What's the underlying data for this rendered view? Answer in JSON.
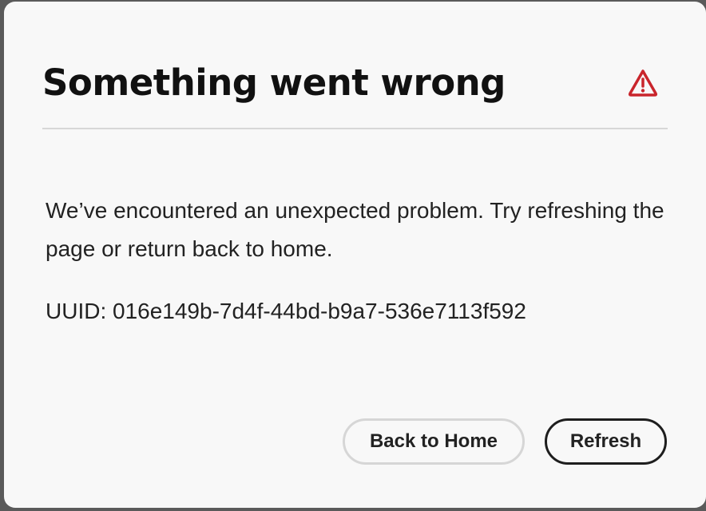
{
  "dialog": {
    "title": "Something went wrong",
    "icon": "alert-triangle-icon",
    "message": "We’ve encountered an unexpected problem. Try refreshing the page or return back to home.",
    "uuid": "UUID: 016e149b-7d4f-44bd-b9a7-536e7113f592",
    "buttons": {
      "home": "Back to Home",
      "refresh": "Refresh"
    }
  },
  "colors": {
    "alert": "#c9252c",
    "text": "#222222",
    "background": "#f8f8f8"
  }
}
